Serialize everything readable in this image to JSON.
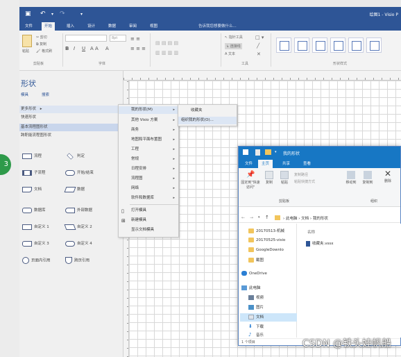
{
  "visio": {
    "window_title": "绘图1 - Visio P",
    "tabs": [
      "文件",
      "开始",
      "插入",
      "设计",
      "数据",
      "审阅",
      "视图"
    ],
    "active_tab": "开始",
    "tell_me": "告诉我您想要做什么...",
    "ribbon": {
      "clipboard": {
        "paste": "粘贴",
        "cut": "剪切",
        "copy": "复制",
        "format_painter": "格式刷",
        "group": "剪贴板"
      },
      "font": {
        "group": "字体",
        "size_placeholder": "8pt"
      },
      "tools": {
        "pointer": "指针工具",
        "connector": "连接线",
        "text": "文本",
        "group": "工具"
      },
      "shape_styles": {
        "group": "形状样式"
      }
    },
    "shapes_pane": {
      "title": "形状",
      "links": [
        "模具",
        "搜索"
      ],
      "stencils": [
        "更多形状",
        "快速形状",
        "基本流程图形状",
        "跨职能流程图形状"
      ],
      "shapes": [
        [
          "流程",
          "判定"
        ],
        [
          "子流程",
          "开始/结束"
        ],
        [
          "文档",
          "数据"
        ],
        [
          "数据库",
          "外部数据"
        ],
        [
          "自定义 1",
          "自定义 2"
        ],
        [
          "自定义 3",
          "自定义 4"
        ],
        [
          "页面内引用",
          "跨页引用"
        ]
      ]
    },
    "menu1": {
      "items": [
        "我的形状(M)",
        "其他 Visio 方案",
        "商务",
        "地图和平面布置图",
        "工程",
        "常规",
        "日程安排",
        "流程图",
        "网络",
        "软件和数据库"
      ],
      "actions": [
        "打开模具",
        "新建模具",
        "显示文档模具"
      ]
    },
    "menu2": {
      "items": [
        "收藏夹",
        "组织我的形状(O)..."
      ]
    }
  },
  "explorer": {
    "title": "我的形状",
    "tabs": [
      "文件",
      "主页",
      "共享",
      "查看"
    ],
    "ribbon": {
      "pin": "固定到\"快速访问\"",
      "copy": "复制",
      "paste": "粘贴",
      "copy_path": "复制路径",
      "paste_shortcut": "粘贴快捷方式",
      "move_to": "移动到",
      "copy_to": "复制到",
      "delete": "删除",
      "clipboard_group": "剪贴板",
      "organize_group": "组织"
    },
    "breadcrumb": [
      "此电脑",
      "文档",
      "我的形状"
    ],
    "nav": {
      "folders": [
        "20170513-机械",
        "20170525-visio",
        "GoogleDownlo",
        "截图"
      ],
      "onedrive": "OneDrive",
      "this_pc": "此电脑",
      "pc_items": [
        "视频",
        "图片",
        "文档",
        "下载",
        "音乐"
      ]
    },
    "column_header": "名称",
    "files": [
      "收藏夹.vssx"
    ],
    "status": "1 个项目"
  },
  "watermark": "CSDN @铁头娃帆船",
  "colors": {
    "visio_blue": "#2e5596",
    "explorer_blue": "#1777c4",
    "folder": "#f2c55c"
  }
}
